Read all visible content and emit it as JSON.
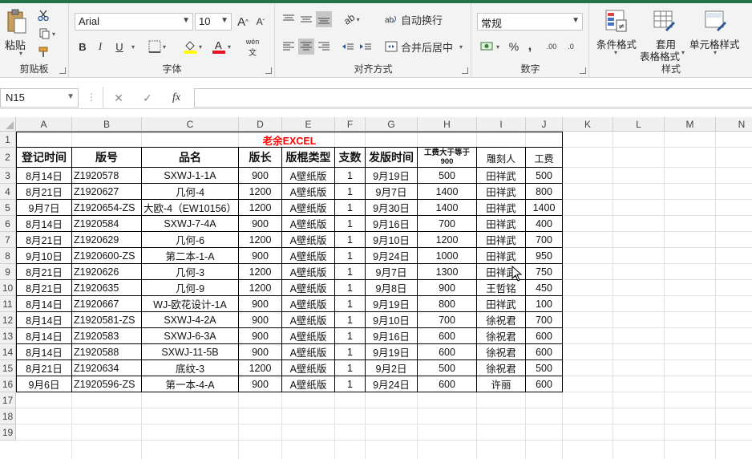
{
  "ribbon": {
    "clipboard": {
      "paste": "粘贴",
      "label": "剪贴板"
    },
    "font": {
      "name": "Arial",
      "size": "10",
      "bold": "B",
      "italic": "I",
      "underline": "U",
      "phonetic": "wén",
      "label": "字体"
    },
    "alignment": {
      "wrap": "自动换行",
      "merge": "合并后居中",
      "label": "对齐方式"
    },
    "number": {
      "format": "常规",
      "percent": "%",
      "comma": ",",
      "inc_decimal": ".00",
      "dec_decimal": ".0",
      "label": "数字"
    },
    "styles": {
      "conditional": "条件格式",
      "table_1": "套用",
      "table_2": "表格格式",
      "cell_styles": "单元格样式",
      "label": "样式"
    }
  },
  "formula_bar": {
    "name_box": "N15",
    "fx": "fx",
    "cancel": "✕",
    "confirm": "✓"
  },
  "columns": [
    "A",
    "B",
    "C",
    "D",
    "E",
    "F",
    "G",
    "H",
    "I",
    "J",
    "K",
    "L",
    "M",
    "N"
  ],
  "rows": [
    "1",
    "2",
    "3",
    "4",
    "5",
    "6",
    "7",
    "8",
    "9",
    "10",
    "11",
    "12",
    "13",
    "14",
    "15",
    "16",
    "17",
    "18",
    "19"
  ],
  "sheet": {
    "title": "老余EXCEL",
    "headers": [
      "登记时间",
      "版号",
      "品名",
      "版长",
      "版棍类型",
      "支数",
      "发版时间",
      "工费大于等于900",
      "雕刻人",
      "工费"
    ],
    "data": [
      [
        "8月14日",
        "Z1920578",
        "SXWJ-1-1A",
        "900",
        "A壁纸版",
        "1",
        "9月19日",
        "500",
        "田祥武",
        "500"
      ],
      [
        "8月21日",
        "Z1920627",
        "几何-4",
        "1200",
        "A壁纸版",
        "1",
        "9月7日",
        "1400",
        "田祥武",
        "800"
      ],
      [
        "9月7日",
        "Z1920654-ZS",
        "大欧-4（EW10156）",
        "1200",
        "A壁纸版",
        "1",
        "9月30日",
        "1400",
        "田祥武",
        "1400"
      ],
      [
        "8月14日",
        "Z1920584",
        "SXWJ-7-4A",
        "900",
        "A壁纸版",
        "1",
        "9月16日",
        "700",
        "田祥武",
        "400"
      ],
      [
        "8月21日",
        "Z1920629",
        "几何-6",
        "1200",
        "A壁纸版",
        "1",
        "9月10日",
        "1200",
        "田祥武",
        "700"
      ],
      [
        "9月10日",
        "Z1920600-ZS",
        "第二本-1-A",
        "900",
        "A壁纸版",
        "1",
        "9月24日",
        "1000",
        "田祥武",
        "950"
      ],
      [
        "8月21日",
        "Z1920626",
        "几何-3",
        "1200",
        "A壁纸版",
        "1",
        "9月7日",
        "1300",
        "田祥武",
        "750"
      ],
      [
        "8月21日",
        "Z1920635",
        "几何-9",
        "1200",
        "A壁纸版",
        "1",
        "9月8日",
        "900",
        "王哲铭",
        "450"
      ],
      [
        "8月14日",
        "Z1920667",
        "WJ-欧花设计-1A",
        "900",
        "A壁纸版",
        "1",
        "9月19日",
        "800",
        "田祥武",
        "100"
      ],
      [
        "8月14日",
        "Z1920581-ZS",
        "SXWJ-4-2A",
        "900",
        "A壁纸版",
        "1",
        "9月10日",
        "700",
        "徐祝君",
        "700"
      ],
      [
        "8月14日",
        "Z1920583",
        "SXWJ-6-3A",
        "900",
        "A壁纸版",
        "1",
        "9月16日",
        "600",
        "徐祝君",
        "600"
      ],
      [
        "8月14日",
        "Z1920588",
        "SXWJ-11-5B",
        "900",
        "A壁纸版",
        "1",
        "9月19日",
        "600",
        "徐祝君",
        "600"
      ],
      [
        "8月21日",
        "Z1920634",
        "底纹-3",
        "1200",
        "A壁纸版",
        "1",
        "9月2日",
        "500",
        "徐祝君",
        "500"
      ],
      [
        "9月6日",
        "Z1920596-ZS",
        "第一本-4-A",
        "900",
        "A壁纸版",
        "1",
        "9月24日",
        "600",
        "许丽",
        "600"
      ]
    ]
  },
  "colors": {
    "title": "#ff0000",
    "accent": "#217346",
    "font_red": "#e81123",
    "fill_yellow": "#ffff00"
  }
}
